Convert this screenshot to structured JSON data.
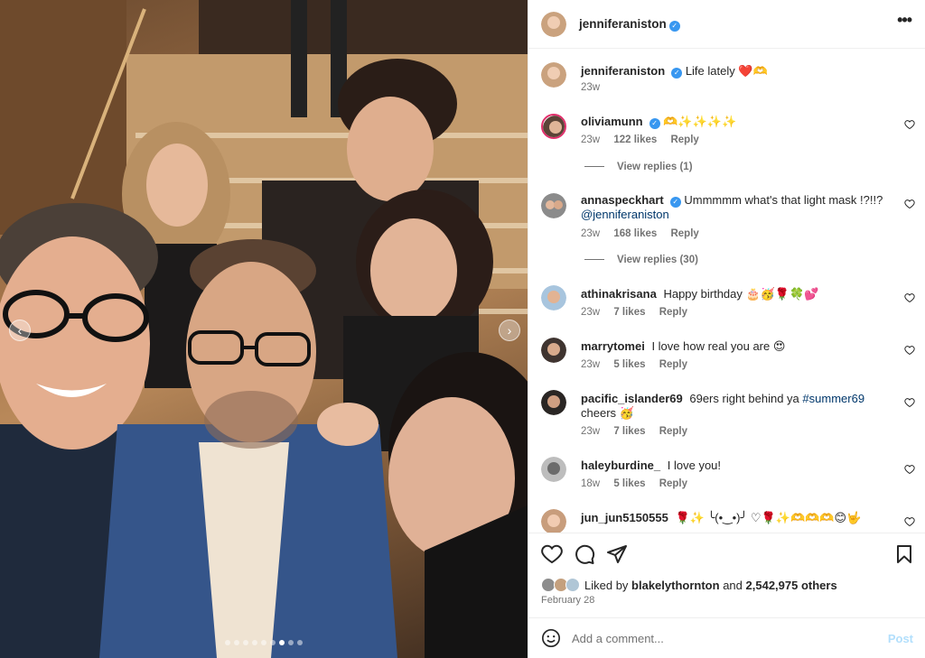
{
  "post": {
    "username": "jenniferaniston",
    "more_icon": "more-horizontal-icon",
    "caption": "Life lately ❤️🫶",
    "caption_time": "23w"
  },
  "comments": [
    {
      "user": "oliviamunn",
      "verified": true,
      "text": "🫶✨✨✨✨",
      "time": "23w",
      "likes": "122 likes",
      "reply": "Reply",
      "view_replies": "View replies (1)"
    },
    {
      "user": "annaspeckhart",
      "verified": true,
      "text": "Ummmmm what's that light mask !?!!?",
      "mention": "@jenniferaniston",
      "time": "23w",
      "likes": "168 likes",
      "reply": "Reply",
      "view_replies": "View replies (30)"
    },
    {
      "user": "athinakrisana",
      "verified": false,
      "text": "Happy birthday 🎂🥳🌹🍀💕",
      "time": "23w",
      "likes": "7 likes",
      "reply": "Reply"
    },
    {
      "user": "marrytomei",
      "verified": false,
      "text": "I love how real you are 😍",
      "time": "23w",
      "likes": "5 likes",
      "reply": "Reply"
    },
    {
      "user": "pacific_islander69",
      "verified": false,
      "text": "69ers right behind ya",
      "hashtag": "#summer69",
      "text2": "cheers 🥳",
      "time": "23w",
      "likes": "7 likes",
      "reply": "Reply"
    },
    {
      "user": "haleyburdine_",
      "verified": false,
      "text": "I love you!",
      "time": "18w",
      "likes": "5 likes",
      "reply": "Reply"
    },
    {
      "user": "jun_jun5150555",
      "verified": false,
      "text": "🌹✨ ╰(•‿•)╯ ♡🌹✨🫶🫶🫶😊🤟"
    }
  ],
  "actions": {
    "like_icon": "heart-icon",
    "comment_icon": "comment-bubble-icon",
    "share_icon": "paper-plane-icon",
    "save_icon": "bookmark-icon"
  },
  "likes": {
    "prefix": "Liked by",
    "user": "blakelythornton",
    "and": "and",
    "count": "2,542,975 others"
  },
  "date": "February 28",
  "add_comment": {
    "placeholder": "Add a comment...",
    "post_label": "Post",
    "emoji_icon": "smiley-icon"
  },
  "carousel": {
    "prev_icon": "chevron-left-icon",
    "next_icon": "chevron-right-icon",
    "total": 9,
    "active_index": 6
  },
  "colors": {
    "link": "#00376b",
    "verified": "#3897f0",
    "meta": "#737373",
    "post_disabled": "#b2dffc"
  }
}
